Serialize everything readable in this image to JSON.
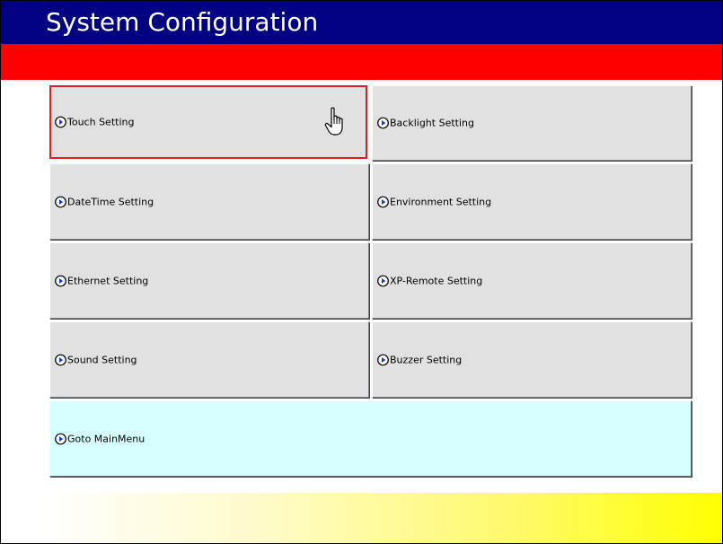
{
  "title": "System Configuration",
  "colors": {
    "title_bar": "#000080",
    "title_text": "#ffffff",
    "red_band": "#ff0000",
    "button_face": "#e1e1e1",
    "goto_face": "#d6ffff",
    "selected_border": "#e02020",
    "footer_gradient_end": "#ffff00"
  },
  "menu": {
    "items": [
      {
        "label": "Touch Setting",
        "icon": "play-arrow-icon",
        "selected": true
      },
      {
        "label": "Backlight Setting",
        "icon": "play-arrow-icon"
      },
      {
        "label": "DateTime Setting",
        "icon": "play-arrow-icon"
      },
      {
        "label": "Environment Setting",
        "icon": "play-arrow-icon"
      },
      {
        "label": "Ethernet Setting",
        "icon": "play-arrow-icon"
      },
      {
        "label": "XP-Remote Setting",
        "icon": "play-arrow-icon"
      },
      {
        "label": "Sound Setting",
        "icon": "play-arrow-icon"
      },
      {
        "label": "Buzzer Setting",
        "icon": "play-arrow-icon"
      }
    ],
    "goto": {
      "label": "Goto MainMenu",
      "icon": "play-arrow-icon"
    }
  },
  "cursor": {
    "icon": "hand-pointer-icon"
  }
}
